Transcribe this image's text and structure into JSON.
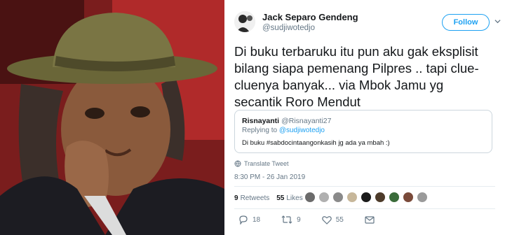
{
  "tweet": {
    "display_name": "Jack Separo Gendeng",
    "handle": "@sudjiwotedjo",
    "follow_label": "Follow",
    "text": "Di buku terbaruku itu pun aku gak eksplisit bilang siapa pemenang Pilpres .. tapi clue-cluenya banyak... via Mbok Jamu yg secantik Roro Mendut",
    "translate_label": "Translate Tweet",
    "timestamp": "8:30 PM - 26 Jan 2019"
  },
  "quoted": {
    "name": "Risnayanti",
    "handle": "@Risnayanti27",
    "replying_prefix": "Replying to",
    "replying_to": "@sudjiwotedjo",
    "text": "Di buku #sabdocintaangonkasih  jg ada ya mbah :)"
  },
  "stats": {
    "retweets_count": "9",
    "retweets_label": "Retweets",
    "likes_count": "55",
    "likes_label": "Likes",
    "liker_colors": [
      "#6b6b6b",
      "#b0b0b0",
      "#8a8a8a",
      "#c7b79a",
      "#1a1a1a",
      "#4d3b2a",
      "#3a6b3a",
      "#7a4a3a",
      "#9a9a9a"
    ]
  },
  "actions": {
    "reply_count": "18",
    "retweet_count": "9",
    "like_count": "55"
  },
  "colors": {
    "accent": "#1da1f2",
    "secondary_text": "#657786",
    "border": "#e6ecf0"
  }
}
